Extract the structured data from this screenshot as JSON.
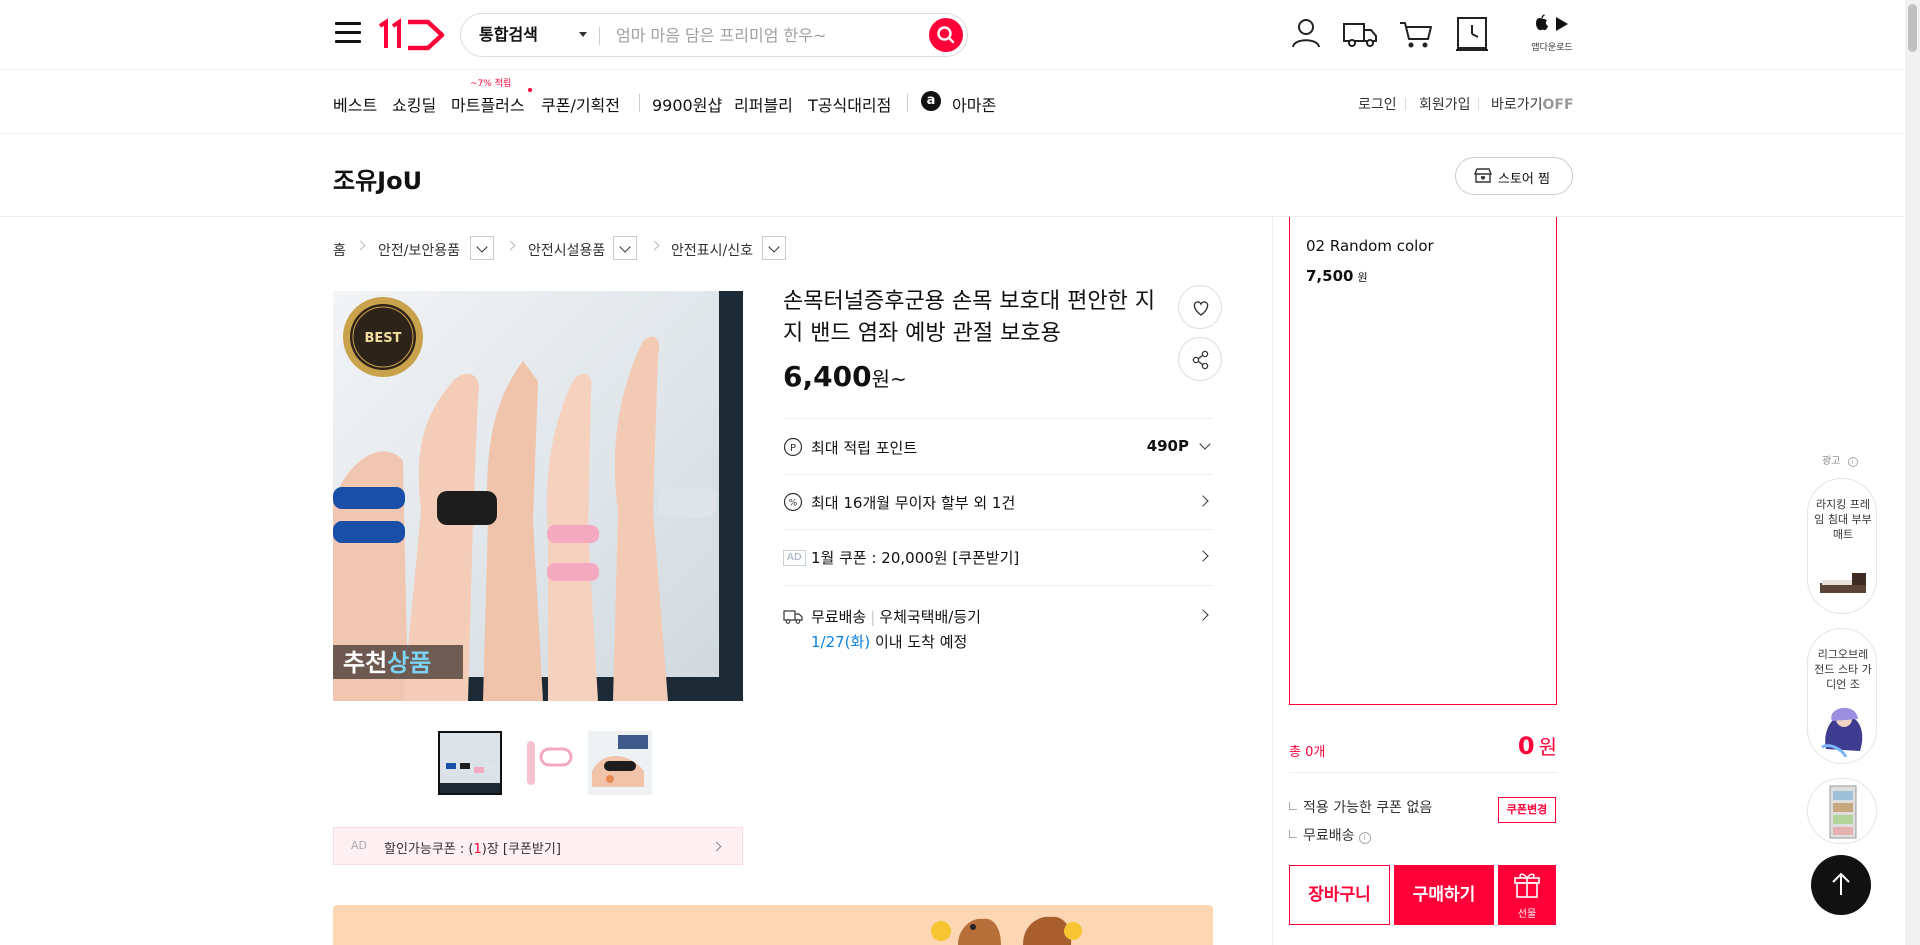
{
  "header": {
    "search_scope": "통합검색",
    "search_placeholder": "엄마 마음 담은 프리미엄 한우~",
    "app_download": "앱다운로드"
  },
  "nav": {
    "items": [
      "베스트",
      "쇼킹딜",
      "마트플러스",
      "쿠폰/기획전",
      "9900원샵",
      "리퍼블리",
      "T공식대리점",
      "아마존"
    ],
    "badge": "~7% 적립",
    "login": "로그인",
    "signup": "회원가입",
    "shortcut": "바로가기",
    "shortcut_state": "OFF"
  },
  "store": {
    "name": "조유JoU",
    "follow_label": "스토어 찜"
  },
  "breadcrumb": [
    "홈",
    "안전/보안용품",
    "안전시설용품",
    "안전표시/신호"
  ],
  "product": {
    "title": "손목터널증후군용 손목 보호대 편안한 지지 밴드 염좌 예방 관절 보호용",
    "price": "6,400",
    "price_unit": "원~",
    "image_badge": "BEST",
    "image_caption_1": "추천",
    "image_caption_2": "상품",
    "points_label": "최대 적립 포인트",
    "points_value": "490P",
    "installment": "최대 16개월 무이자 할부 외 1건",
    "ad_tag": "AD",
    "coupon_offer": "1월 쿠폰 : 20,000원 [쿠폰받기]",
    "shipping_free": "무료배송",
    "shipping_method": "우체국택배/등기",
    "delivery_date": "1/27(화)",
    "delivery_suffix": "이내 도착 예정",
    "discount_coupon_ad": "AD",
    "discount_coupon_prefix": "할인가능쿠폰 : (",
    "discount_coupon_count": "1",
    "discount_coupon_suffix": ")장 [쿠폰받기]"
  },
  "order": {
    "option_name": "02 Random color",
    "option_price": "7,500",
    "option_won": "원",
    "total_count": "총 0개",
    "total_price": "0",
    "total_won": "원",
    "no_coupon": "적용 가능한 쿠폰 없음",
    "coupon_change": "쿠폰변경",
    "free_shipping": "무료배송",
    "cart_btn": "장바구니",
    "buy_btn": "구매하기",
    "gift_btn": "선물"
  },
  "ads": {
    "label": "광고",
    "item1": "라지킹 프레임 침대 부부 매트",
    "item2": "리그오브레전드 스타 가디언 조"
  },
  "colors": {
    "brand": "#ff0038",
    "link_blue": "#0b83e6"
  }
}
